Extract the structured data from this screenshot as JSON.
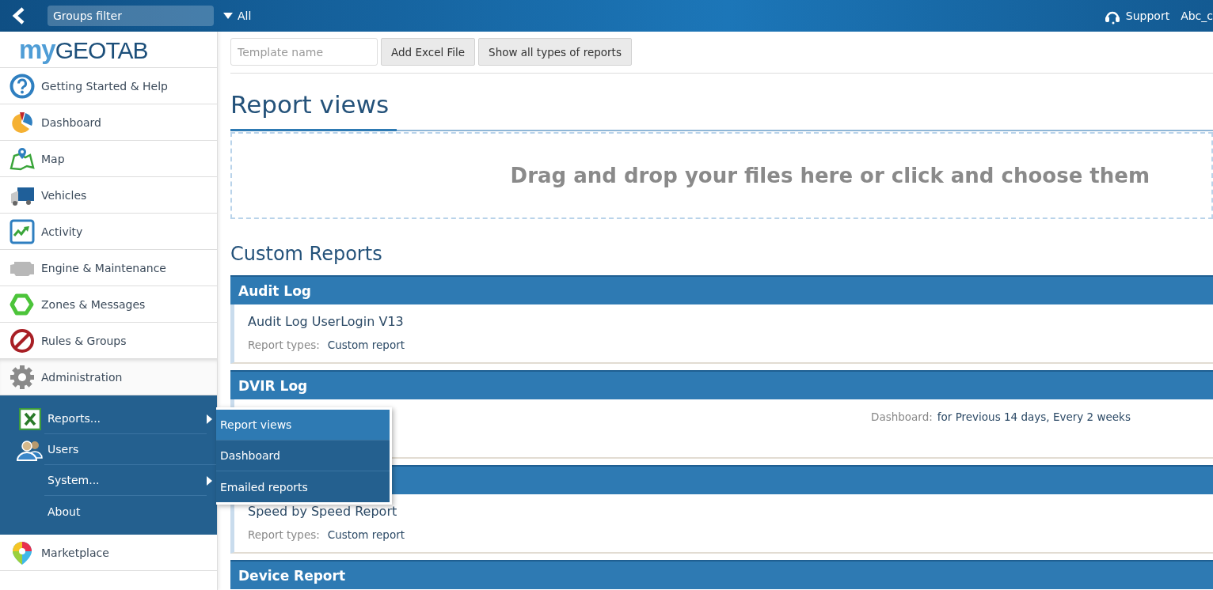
{
  "topbar": {
    "groups_filter": {
      "placeholder": "Groups filter"
    },
    "filter_value": "All",
    "support": "Support",
    "user": "Abc_c"
  },
  "sidebar": {
    "logo": {
      "prefix": "my",
      "name": "GEOTAB"
    },
    "items": [
      {
        "label": "Getting Started & Help",
        "kind": "help",
        "expanded": false
      },
      {
        "label": "Dashboard",
        "kind": "dashboard",
        "expanded": false
      },
      {
        "label": "Map",
        "kind": "map",
        "expanded": false
      },
      {
        "label": "Vehicles",
        "kind": "vehicles",
        "expanded": false
      },
      {
        "label": "Activity",
        "kind": "activity",
        "expanded": false
      },
      {
        "label": "Engine & Maintenance",
        "kind": "engine",
        "expanded": false
      },
      {
        "label": "Zones & Messages",
        "kind": "zones",
        "expanded": false
      },
      {
        "label": "Rules & Groups",
        "kind": "rules",
        "expanded": false
      },
      {
        "label": "Administration",
        "kind": "admin",
        "expanded": true,
        "children": [
          {
            "label": "Reports...",
            "kind": "reports",
            "has_submenu": true
          },
          {
            "label": "Users",
            "kind": "users",
            "has_submenu": false
          },
          {
            "label": "System...",
            "kind": "none",
            "has_submenu": true
          },
          {
            "label": "About",
            "kind": "none",
            "has_submenu": false
          }
        ]
      },
      {
        "label": "Marketplace",
        "kind": "marketplace",
        "expanded": false
      }
    ]
  },
  "flyout_menu": {
    "items": [
      {
        "label": "Report views",
        "selected": true
      },
      {
        "label": "Dashboard",
        "selected": false
      },
      {
        "label": "Emailed reports",
        "selected": false
      }
    ]
  },
  "toolbar": {
    "template_name": {
      "placeholder": "Template name"
    },
    "buttons": [
      "Add Excel File",
      "Show all types of reports"
    ]
  },
  "page_title": "Report views",
  "drop_zone": "Drag and drop your files here or click and choose them",
  "section_title": "Custom Reports",
  "report_groups": [
    {
      "title": "Audit Log",
      "reports": [
        {
          "name": "Audit Log UserLogin V13",
          "types_label": "Report types:",
          "types": "Custom report"
        }
      ]
    },
    {
      "title": "DVIR Log",
      "reports": [
        {
          "dashboard_label": "Dashboard:",
          "dashboard": "for Previous 14 days, Every 2 weeks"
        }
      ]
    },
    {
      "reports": [
        {
          "name": "Speed by Speed Report",
          "types_label": "Report types:",
          "types": "Custom report"
        }
      ]
    },
    {
      "title": "Device Report"
    }
  ]
}
